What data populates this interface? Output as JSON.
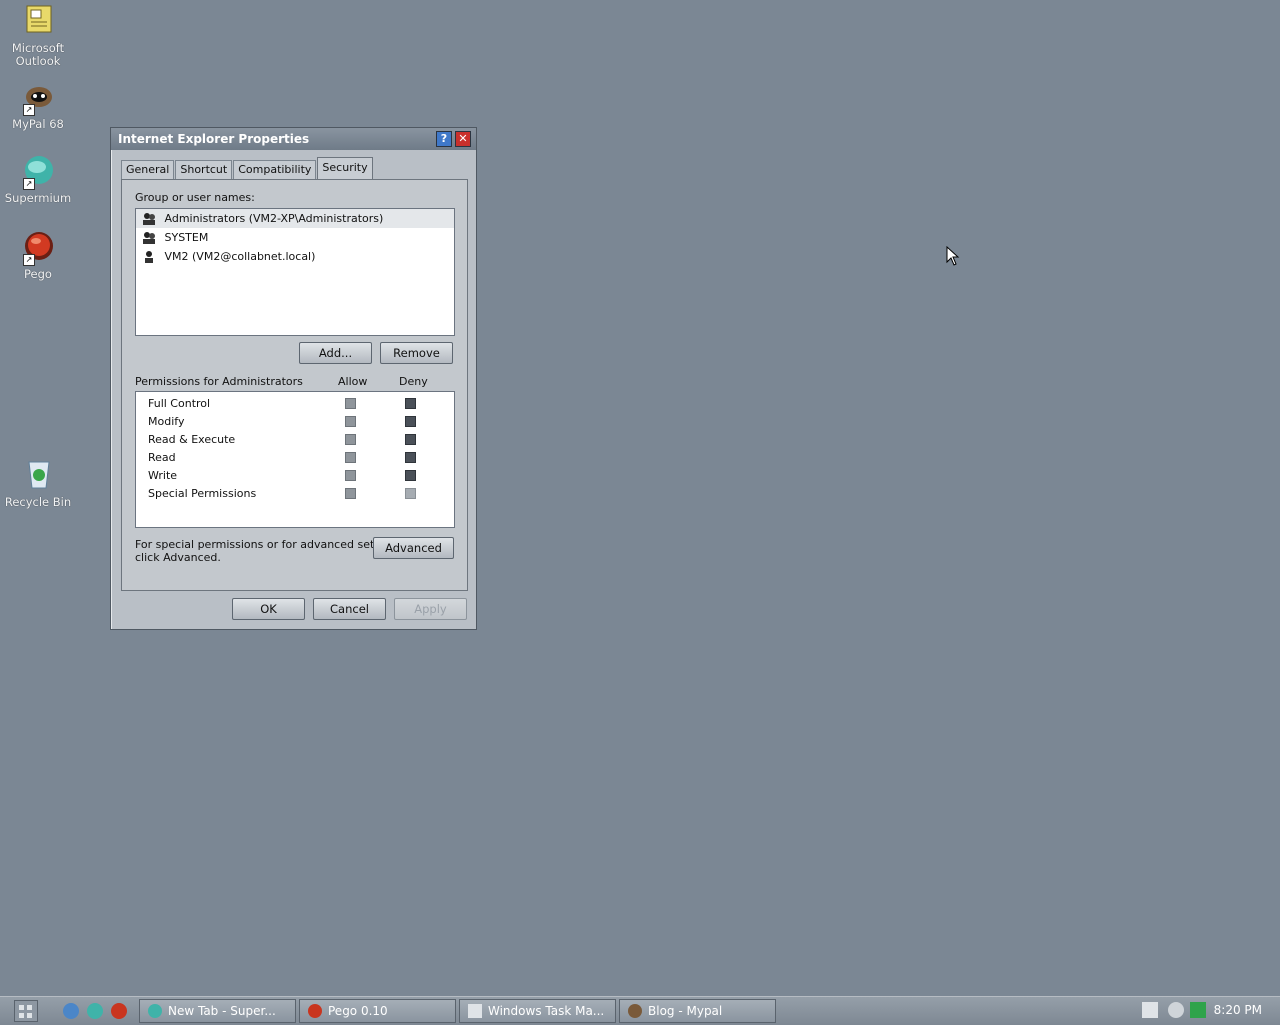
{
  "desktop": {
    "icons": [
      {
        "label_line1": "Microsoft",
        "label_line2": "Outlook",
        "icon": "outlook-icon"
      },
      {
        "label": "MyPal 68",
        "icon": "mypal-icon"
      },
      {
        "label": "Supermium",
        "icon": "supermium-icon"
      },
      {
        "label": "Pego",
        "icon": "pego-icon"
      },
      {
        "label": "Recycle Bin",
        "icon": "recycle-bin-icon"
      }
    ]
  },
  "dialog": {
    "title": "Internet Explorer Properties",
    "tabs": [
      {
        "label": "General"
      },
      {
        "label": "Shortcut"
      },
      {
        "label": "Compatibility"
      },
      {
        "label": "Security",
        "active": true
      }
    ],
    "group_label": "Group or user names:",
    "users": [
      {
        "name": "Administrators (VM2-XP\\Administrators)",
        "selected": true
      },
      {
        "name": "SYSTEM"
      },
      {
        "name": "VM2 (VM2@collabnet.local)"
      }
    ],
    "add_label": "Add...",
    "remove_label": "Remove",
    "permissions_label": "Permissions for Administrators",
    "allow_label": "Allow",
    "deny_label": "Deny",
    "permissions": [
      {
        "name": "Full Control",
        "allow": true,
        "deny": true
      },
      {
        "name": "Modify",
        "allow": true,
        "deny": true
      },
      {
        "name": "Read & Execute",
        "allow": true,
        "deny": true
      },
      {
        "name": "Read",
        "allow": true,
        "deny": true
      },
      {
        "name": "Write",
        "allow": true,
        "deny": true
      },
      {
        "name": "Special Permissions",
        "allow": true,
        "deny": false
      }
    ],
    "advanced_text_line1": "For special permissions or for advanced settings,",
    "advanced_text_line2": "click Advanced.",
    "advanced_label": "Advanced",
    "ok_label": "OK",
    "cancel_label": "Cancel",
    "apply_label": "Apply"
  },
  "taskbar": {
    "tasks": [
      {
        "label": "New Tab - Super...",
        "icon": "supermium-icon"
      },
      {
        "label": "Pego 0.10",
        "icon": "pego-icon"
      },
      {
        "label": "Windows Task Ma...",
        "icon": "task-manager-icon"
      },
      {
        "label": "Blog - Mypal",
        "icon": "mypal-icon"
      }
    ],
    "clock": "8:20 PM"
  },
  "colors": {
    "desktop": "#7b8794",
    "dialog": "#b9bfc6",
    "close_button": "#c9302c",
    "help_button": "#3f78c9"
  }
}
